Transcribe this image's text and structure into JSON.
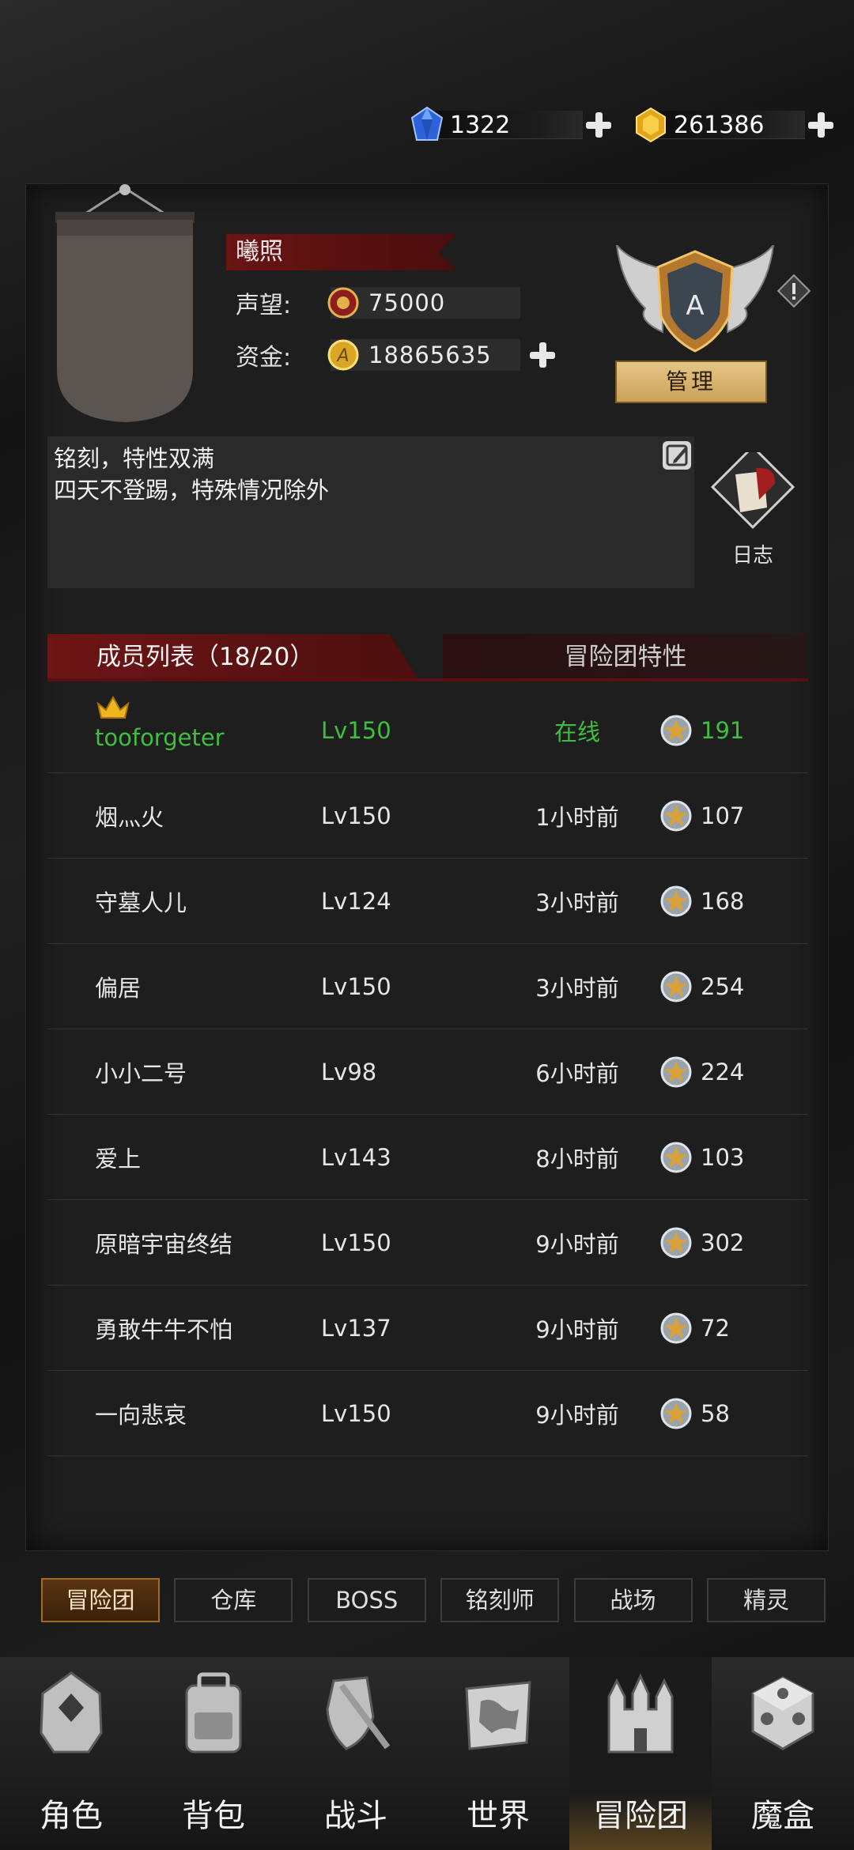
{
  "currencies": {
    "diamond": {
      "icon": "blue-diamond-icon",
      "value": "1322"
    },
    "gold": {
      "icon": "gold-gem-icon",
      "value": "261386"
    }
  },
  "guild": {
    "name": "曦照",
    "reputation_label": "声望:",
    "reputation_value": "75000",
    "funds_label": "资金:",
    "funds_value": "18865635",
    "rank_letter": "A",
    "manage_label": "管理",
    "description_line1": "铭刻，特性双满",
    "description_line2": "四天不登踢，特殊情况除外",
    "log_label": "日志"
  },
  "tabs": {
    "members": "成员列表（18/20）",
    "traits": "冒险团特性"
  },
  "members": [
    {
      "name": "tooforgeter",
      "level": "Lv150",
      "status": "在线",
      "points": "191",
      "online": true,
      "leader": true
    },
    {
      "name": "烟灬火",
      "level": "Lv150",
      "status": "1小时前",
      "points": "107"
    },
    {
      "name": "守墓人儿",
      "level": "Lv124",
      "status": "3小时前",
      "points": "168"
    },
    {
      "name": "偏居",
      "level": "Lv150",
      "status": "3小时前",
      "points": "254"
    },
    {
      "name": "小小二号",
      "level": "Lv98",
      "status": "6小时前",
      "points": "224"
    },
    {
      "name": "爱上",
      "level": "Lv143",
      "status": "8小时前",
      "points": "103"
    },
    {
      "name": "原暗宇宙终结",
      "level": "Lv150",
      "status": "9小时前",
      "points": "302"
    },
    {
      "name": "勇敢牛牛不怕",
      "level": "Lv137",
      "status": "9小时前",
      "points": "72"
    },
    {
      "name": "一向悲哀",
      "level": "Lv150",
      "status": "9小时前",
      "points": "58"
    }
  ],
  "subnav": [
    "冒险团",
    "仓库",
    "BOSS",
    "铭刻师",
    "战场",
    "精灵"
  ],
  "bottomnav": [
    "角色",
    "背包",
    "战斗",
    "世界",
    "冒险团",
    "魔盒"
  ],
  "colors": {
    "accent_red": "#6e1515",
    "online_green": "#3fbf3f",
    "gold": "#c9a25a"
  }
}
